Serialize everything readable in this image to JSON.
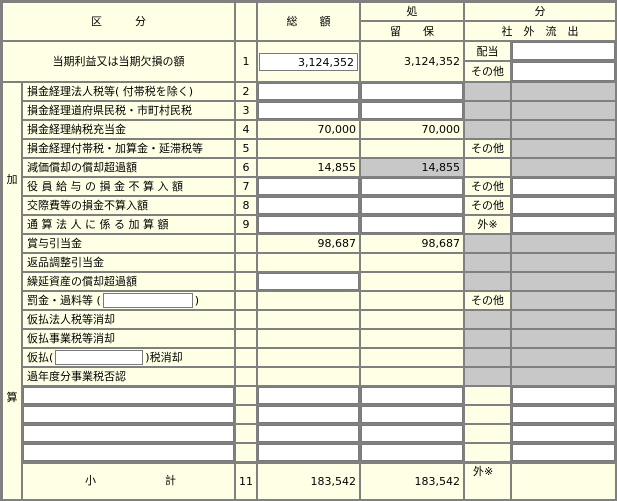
{
  "header": {
    "kubun": "区　　　分",
    "sougaku": "総　　額",
    "sho": "処",
    "bun": "分",
    "ryuho": "留　　保",
    "shagai": "社　外　流　出"
  },
  "top_row": {
    "label": "当期利益又は当期欠損の額",
    "no": "1",
    "sougaku": "3,124,352",
    "ryuho": "3,124,352",
    "haito": "配当",
    "sonota": "その他"
  },
  "side_labels": {
    "ka": "加",
    "san": "算"
  },
  "rows": [
    {
      "label": "損金経理法人税等( 付帯税を除く)",
      "no": "2",
      "sougaku": "",
      "ryuho": "",
      "type": ""
    },
    {
      "label": "損金経理道府県民税・市町村民税",
      "no": "3",
      "sougaku": "",
      "ryuho": "",
      "type": ""
    },
    {
      "label": "損金経理納税充当金",
      "no": "4",
      "sougaku": "70,000",
      "ryuho": "70,000",
      "type": ""
    },
    {
      "label": "損金経理付帯税・加算金・延滞税等",
      "no": "5",
      "sougaku": "",
      "ryuho": "",
      "type": "その他"
    },
    {
      "label": "減価償却の償却超過額",
      "no": "6",
      "sougaku": "14,855",
      "ryuho": "14,855",
      "type": ""
    },
    {
      "label": "役 員 給 与 の 損 金 不 算 入 額",
      "no": "7",
      "sougaku": "",
      "ryuho": "",
      "type": "その他"
    },
    {
      "label": "交際費等の損金不算入額",
      "no": "8",
      "sougaku": "",
      "ryuho": "",
      "type": "その他"
    },
    {
      "label": "通 算 法 人 に 係 る 加 算 額",
      "no": "9",
      "sougaku": "",
      "ryuho": "",
      "type": "外※"
    },
    {
      "label": "賞与引当金",
      "no": "",
      "sougaku": "98,687",
      "ryuho": "98,687",
      "type": ""
    },
    {
      "label": "返品調整引当金",
      "no": "",
      "sougaku": "",
      "ryuho": "",
      "type": ""
    },
    {
      "label": "繰延資産の償却超過額",
      "no": "",
      "sougaku": "",
      "ryuho": "",
      "type": ""
    },
    {
      "label": "罰金・過料等 (",
      "label_end": ")",
      "no": "",
      "sougaku": "",
      "ryuho": "",
      "type": "その他"
    },
    {
      "label": "仮払法人税等消却",
      "no": "",
      "sougaku": "",
      "ryuho": "",
      "type": ""
    },
    {
      "label": "仮払事業税等消却",
      "no": "",
      "sougaku": "",
      "ryuho": "",
      "type": ""
    },
    {
      "label": "仮払(",
      "label_end": ")税消却",
      "no": "",
      "sougaku": "",
      "ryuho": "",
      "type": ""
    },
    {
      "label": "過年度分事業税否認",
      "no": "",
      "sougaku": "",
      "ryuho": "",
      "type": ""
    }
  ],
  "subtotal": {
    "label1": "小",
    "label2": "計",
    "no": "11",
    "sougaku": "183,542",
    "ryuho": "183,542",
    "type": "外※"
  }
}
